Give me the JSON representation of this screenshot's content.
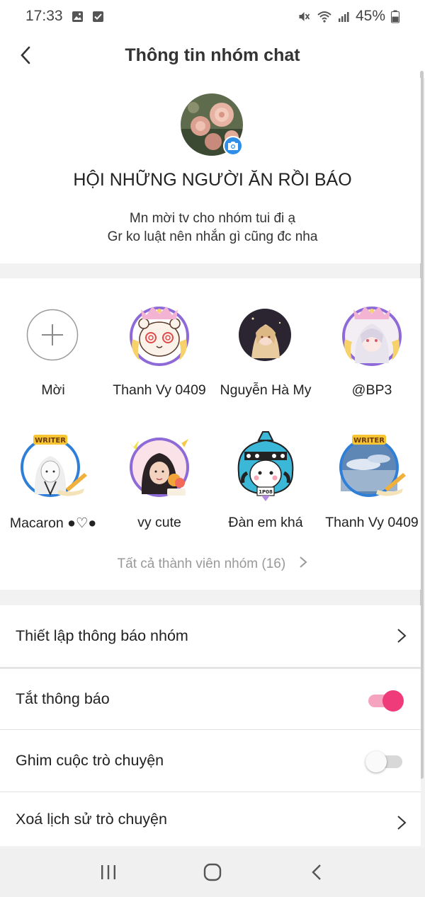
{
  "status_bar": {
    "time": "17:33",
    "battery": "45%"
  },
  "header": {
    "title": "Thông tin nhóm chat"
  },
  "group": {
    "name": "HỘI NHỮNG NGƯỜI ĂN RỒI BÁO",
    "description_line1": "Mn mời tv cho nhóm tui đi ạ",
    "description_line2": "Gr ko luật nên nhắn gì cũng đc nha"
  },
  "members": {
    "invite_label": "Mời",
    "list": [
      {
        "name": "Thanh Vy 0409"
      },
      {
        "name": "Nguyễn Hà My"
      },
      {
        "name": "@BP3"
      },
      {
        "name": "Macaron ●♡●"
      },
      {
        "name": "vy cute"
      },
      {
        "name": "Đàn em khá"
      },
      {
        "name": "Thanh Vy 0409"
      }
    ],
    "all_members_label": "Tất cả thành viên nhóm (16)"
  },
  "settings": {
    "notification_settings": "Thiết lập thông báo nhóm",
    "mute_notifications": "Tắt thông báo",
    "mute_on": true,
    "pin_conversation": "Ghim cuộc trò chuyện",
    "pin_on": false,
    "clear_history": "Xoá lịch sử trò chuyện"
  },
  "colors": {
    "accent": "#f03b7a",
    "camera_badge": "#2f8fe8",
    "frame_purple": "#8e6ad8"
  }
}
